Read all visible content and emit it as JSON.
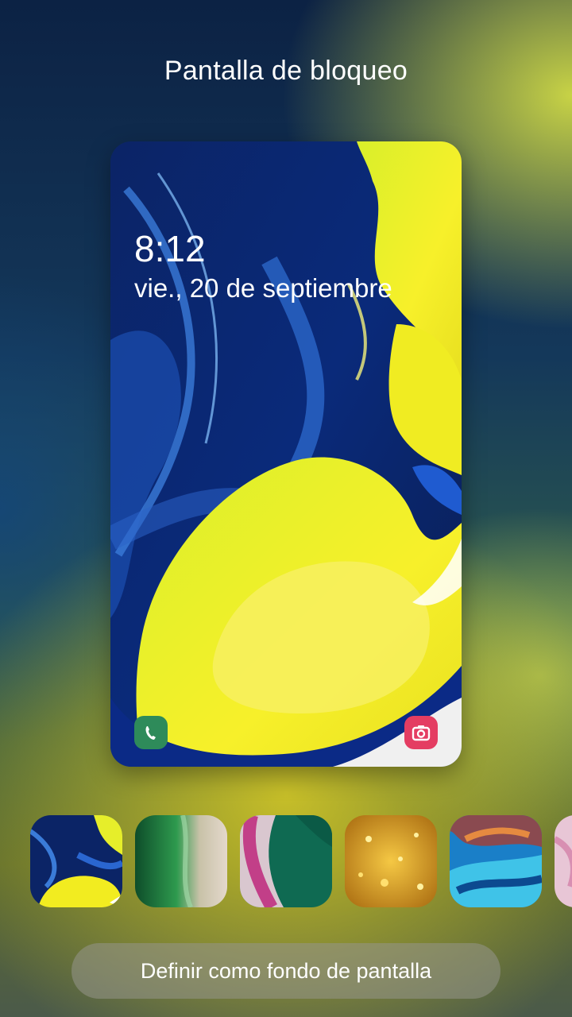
{
  "header": {
    "title": "Pantalla de bloqueo"
  },
  "lockscreen": {
    "time": "8:12",
    "date": "vie., 20 de septiembre",
    "left_shortcut_icon": "phone-icon",
    "right_shortcut_icon": "camera-icon"
  },
  "wallpapers": [
    {
      "name": "wallpaper-blue-yellow",
      "selected": true
    },
    {
      "name": "wallpaper-green"
    },
    {
      "name": "wallpaper-pink-green"
    },
    {
      "name": "wallpaper-gold"
    },
    {
      "name": "wallpaper-blue-orange"
    },
    {
      "name": "wallpaper-pink-partial"
    }
  ],
  "action": {
    "set_wallpaper_label": "Definir como fondo de pantalla"
  },
  "colors": {
    "accent_yellow": "#f2ee1e",
    "deep_blue": "#0a1f5c",
    "phone_green": "#2e8b5a",
    "camera_pink": "#e43d62"
  }
}
